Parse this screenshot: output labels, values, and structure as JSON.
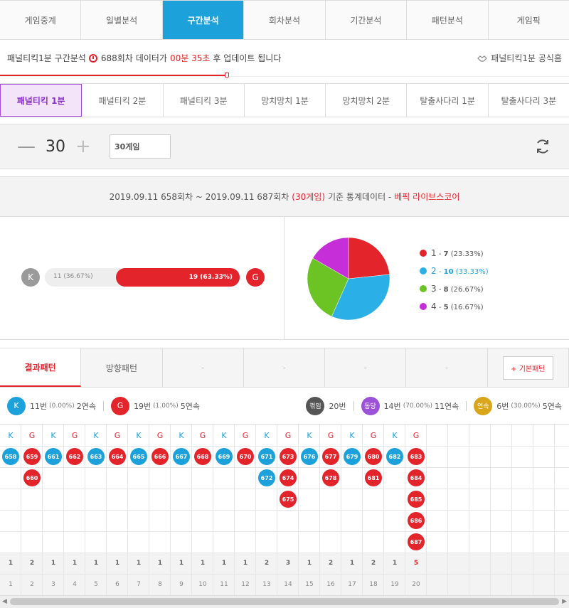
{
  "tabs": [
    "게임중계",
    "일별분석",
    "구간분석",
    "회차분석",
    "기간분석",
    "패턴분석",
    "게임픽"
  ],
  "update": {
    "prefix": "패널티킥1분 구간분석",
    "round": "688회차",
    "mid": "데이터가",
    "time": "00분 35초",
    "suffix": "후 업데이트 됩니다",
    "home": "패널티킥1분 공식홈"
  },
  "subtabs": [
    "패널티킥 1분",
    "패널티킥 2분",
    "패널티킥 3분",
    "망치망치 1분",
    "망치망치 2분",
    "탈출사다리 1분",
    "탈출사다리 3분"
  ],
  "control": {
    "minus": "—",
    "count": "30",
    "plus": "+",
    "input": "30게임"
  },
  "stat_header": {
    "range": "2019.09.11 658회차 ~ 2019.09.11 687회차",
    "games": "(30게임)",
    "text": "기준 통계데이터 -",
    "brand": "베픽 라이브스코어"
  },
  "ratio": {
    "k_label": "K",
    "g_label": "G",
    "k_text": "11 (36.67%)",
    "g_text": "19 (63.33%)",
    "g_fraction": 0.6333
  },
  "colors": {
    "k": "#1da1db",
    "g": "#e3242b",
    "accent": "#1da1db",
    "gray": "#9a9a9a",
    "pie1": "#e3242b",
    "pie2": "#2ab0e6",
    "pie3": "#6cc424",
    "pie4": "#c62fd8",
    "streak": "#9c52d6",
    "combo": "#d9a51a",
    "flip": "#555555"
  },
  "chart_data": {
    "type": "pie",
    "labels": [
      "1",
      "2",
      "3",
      "4"
    ],
    "values": [
      7,
      10,
      8,
      5
    ],
    "percent": [
      "(23.33%)",
      "(33.33%)",
      "(26.67%)",
      "(16.67%)"
    ]
  },
  "ptabs": [
    "결과패턴",
    "방향패턴",
    "-",
    "-",
    "-",
    "-",
    "+ 기본패턴"
  ],
  "summary": {
    "k": "K",
    "k_text": "11번",
    "k_pct": "(0.00%)",
    "k_run": "2연속",
    "g": "G",
    "g_text": "19번",
    "g_pct": "(1.00%)",
    "g_run": "5연속",
    "flip": "꺾임",
    "flip_text": "20번",
    "dong": "동당",
    "dong_text": "14번",
    "dong_pct": "(70.00%)",
    "dong_run": "11연속",
    "yeon": "연속",
    "yeon_text": "6번",
    "yeon_pct": "(30.00%)",
    "yeon_run": "5연속"
  },
  "columns": [
    {
      "h": "K",
      "balls": [
        "658"
      ],
      "count": "1",
      "idx": "1"
    },
    {
      "h": "G",
      "balls": [
        "659",
        "660"
      ],
      "count": "2",
      "idx": "2"
    },
    {
      "h": "K",
      "balls": [
        "661"
      ],
      "count": "1",
      "idx": "3"
    },
    {
      "h": "G",
      "balls": [
        "662"
      ],
      "count": "1",
      "idx": "4"
    },
    {
      "h": "K",
      "balls": [
        "663"
      ],
      "count": "1",
      "idx": "5"
    },
    {
      "h": "G",
      "balls": [
        "664"
      ],
      "count": "1",
      "idx": "6"
    },
    {
      "h": "K",
      "balls": [
        "665"
      ],
      "count": "1",
      "idx": "7"
    },
    {
      "h": "G",
      "balls": [
        "666"
      ],
      "count": "1",
      "idx": "8"
    },
    {
      "h": "K",
      "balls": [
        "667"
      ],
      "count": "1",
      "idx": "9"
    },
    {
      "h": "G",
      "balls": [
        "668"
      ],
      "count": "1",
      "idx": "10"
    },
    {
      "h": "K",
      "balls": [
        "669"
      ],
      "count": "1",
      "idx": "11"
    },
    {
      "h": "G",
      "balls": [
        "670"
      ],
      "count": "1",
      "idx": "12"
    },
    {
      "h": "K",
      "balls": [
        "671",
        "672"
      ],
      "count": "2",
      "idx": "13"
    },
    {
      "h": "G",
      "balls": [
        "673",
        "674",
        "675"
      ],
      "count": "3",
      "idx": "14"
    },
    {
      "h": "K",
      "balls": [
        "676"
      ],
      "count": "1",
      "idx": "15"
    },
    {
      "h": "G",
      "balls": [
        "677",
        "678"
      ],
      "count": "2",
      "idx": "16"
    },
    {
      "h": "K",
      "balls": [
        "679"
      ],
      "count": "1",
      "idx": "17"
    },
    {
      "h": "G",
      "balls": [
        "680",
        "681"
      ],
      "count": "2",
      "idx": "18"
    },
    {
      "h": "K",
      "balls": [
        "682"
      ],
      "count": "1",
      "idx": "19"
    },
    {
      "h": "G",
      "balls": [
        "683",
        "684",
        "685",
        "686",
        "687"
      ],
      "count": "5",
      "idx": "20"
    }
  ]
}
